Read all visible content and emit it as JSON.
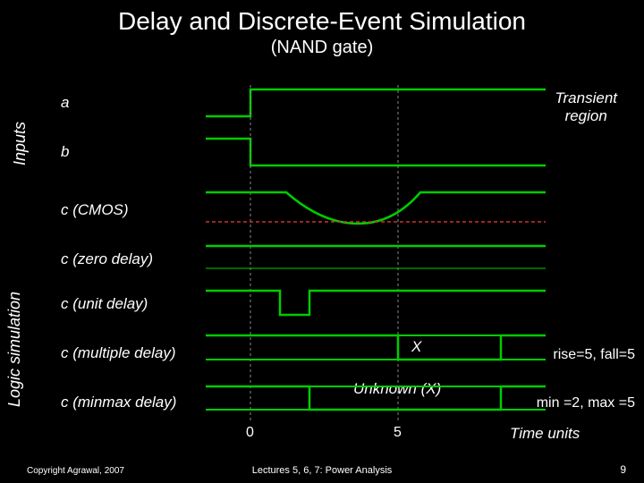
{
  "title": "Delay and Discrete-Event Simulation",
  "subtitle": "(NAND gate)",
  "ylabels": {
    "inputs": "Inputs",
    "logic": "Logic simulation"
  },
  "rows": {
    "a": "a",
    "b": "b",
    "cmos": "c  (CMOS)",
    "zero": "c  (zero delay)",
    "unit": "c  (unit delay)",
    "multiple": "c  (multiple delay)",
    "minmax": "c  (minmax delay)"
  },
  "annotations": {
    "transient": "Transient",
    "region": "region",
    "x": "X",
    "unknown": "Unknown (X)",
    "rise_fall": "rise=5, fall=5",
    "min_max": "min =2, max =5",
    "time_units": "Time units"
  },
  "ticks": {
    "t0": "0",
    "t5": "5"
  },
  "footer": {
    "left": "Copyright Agrawal, 2007",
    "center": "Lectures 5, 6, 7: Power Analysis",
    "right": "9"
  },
  "chart_data": {
    "type": "timing-diagram",
    "time_axis": {
      "min": 0,
      "max": 10,
      "ticks": [
        0,
        5
      ],
      "unit": "Time units"
    },
    "signals": [
      {
        "name": "a",
        "group": "Inputs",
        "type": "digital",
        "edges": [
          [
            0,
            0
          ],
          [
            0,
            1
          ],
          [
            10,
            1
          ]
        ]
      },
      {
        "name": "b",
        "group": "Inputs",
        "type": "digital",
        "edges": [
          [
            0,
            1
          ],
          [
            0,
            0
          ],
          [
            10,
            0
          ]
        ]
      },
      {
        "name": "c (CMOS)",
        "group": "",
        "type": "analog",
        "note": "glitch/transient dip between t≈2..5"
      },
      {
        "name": "c (zero delay)",
        "group": "Logic simulation",
        "type": "digital",
        "edges": [
          [
            0,
            1
          ],
          [
            10,
            1
          ]
        ]
      },
      {
        "name": "c (unit delay)",
        "group": "Logic simulation",
        "type": "digital",
        "edges": [
          [
            0,
            1
          ],
          [
            1,
            0
          ],
          [
            2,
            1
          ],
          [
            10,
            1
          ]
        ]
      },
      {
        "name": "c (multiple delay)",
        "group": "Logic simulation",
        "type": "digital-x",
        "rise": 5,
        "fall": 5,
        "segments": [
          [
            0,
            "1"
          ],
          [
            5,
            "X"
          ],
          [
            10,
            "1"
          ]
        ]
      },
      {
        "name": "c (minmax delay)",
        "group": "Logic simulation",
        "type": "digital-x",
        "min": 2,
        "max": 5,
        "segments": [
          [
            0,
            "1"
          ],
          [
            2,
            "X"
          ],
          [
            10,
            "1"
          ]
        ]
      }
    ],
    "annotations": [
      "Transient region",
      "X",
      "Unknown (X)"
    ]
  }
}
